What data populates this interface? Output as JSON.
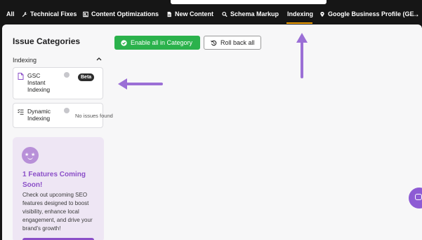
{
  "nav": {
    "items": [
      {
        "label": "All",
        "icon": "none"
      },
      {
        "label": "Technical Fixes",
        "icon": "wrench-icon"
      },
      {
        "label": "Content Optimizations",
        "icon": "content-icon"
      },
      {
        "label": "New Content",
        "icon": "document-icon"
      },
      {
        "label": "Schema Markup",
        "icon": "search-icon"
      },
      {
        "label": "Indexing",
        "icon": "none",
        "active": true
      },
      {
        "label": "Google Business Profile (GE",
        "icon": "map-pin-icon"
      }
    ],
    "more_icon": "arrow-right-icon",
    "active_color": "#f4a100"
  },
  "sidebar": {
    "title": "Issue Categories",
    "section": {
      "label": "Indexing",
      "chevron": "chevron-up-icon"
    },
    "items": [
      {
        "label": "GSC Instant Indexing",
        "badge": "Beta",
        "icon": "file-icon"
      },
      {
        "label": "Dynamic Indexing",
        "status": "No issues found",
        "icon": "list-check-icon"
      }
    ]
  },
  "promo": {
    "title": "1 Features Coming Soon!",
    "text": "Check out upcoming SEO features designed to boost visibility, enhance local engagement, and drive your brand's growth!",
    "accent": "#8b4fc8"
  },
  "toolbar": {
    "enable_label": "Enable all in Category",
    "rollback_label": "Roll back all",
    "enable_color": "#2bb24c"
  },
  "annotations": {
    "arrow_color": "#9b6fd6"
  }
}
